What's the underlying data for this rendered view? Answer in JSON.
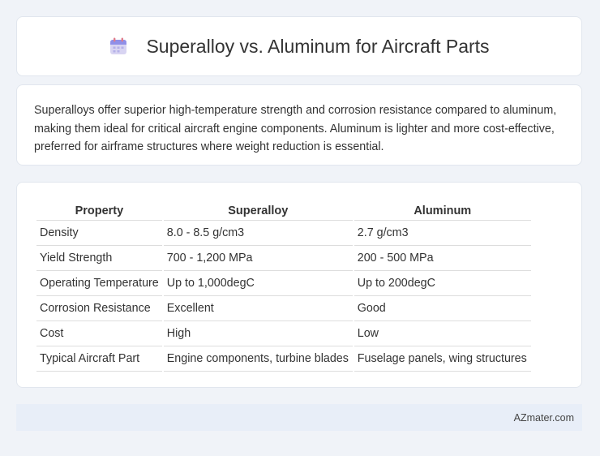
{
  "header": {
    "title": "Superalloy vs. Aluminum for Aircraft Parts",
    "icon": "calendar-icon"
  },
  "summary": {
    "text": "Superalloys offer superior high-temperature strength and corrosion resistance compared to aluminum, making them ideal for critical aircraft engine components. Aluminum is lighter and more cost-effective, preferred for airframe structures where weight reduction is essential."
  },
  "table": {
    "headers": [
      "Property",
      "Superalloy",
      "Aluminum"
    ],
    "rows": [
      [
        "Density",
        "8.0 - 8.5 g/cm3",
        "2.7 g/cm3"
      ],
      [
        "Yield Strength",
        "700 - 1,200 MPa",
        "200 - 500 MPa"
      ],
      [
        "Operating Temperature",
        "Up to 1,000degC",
        "Up to 200degC"
      ],
      [
        "Corrosion Resistance",
        "Excellent",
        "Good"
      ],
      [
        "Cost",
        "High",
        "Low"
      ],
      [
        "Typical Aircraft Part",
        "Engine components, turbine blades",
        "Fuselage panels, wing structures"
      ]
    ]
  },
  "footer": {
    "brand": "AZmater.com"
  }
}
